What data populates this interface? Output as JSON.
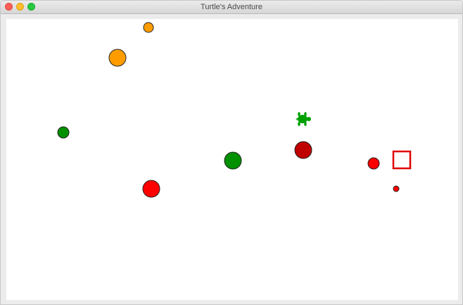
{
  "window": {
    "title": "Turtle's Adventure"
  },
  "colors": {
    "orange": "#ff9d00",
    "green": "#009000",
    "red": "#ff0000",
    "dark_red": "#c00000",
    "turtle": "#00a000",
    "home_outline": "#e00000"
  },
  "sprites": [
    {
      "kind": "ball",
      "color": "orange"
    },
    {
      "kind": "ball",
      "color": "orange"
    },
    {
      "kind": "ball",
      "color": "green"
    },
    {
      "kind": "ball",
      "color": "green"
    },
    {
      "kind": "ball",
      "color": "red"
    },
    {
      "kind": "ball",
      "color": "dark_red"
    },
    {
      "kind": "ball",
      "color": "red"
    },
    {
      "kind": "ball",
      "color": "red"
    },
    {
      "kind": "player-turtle",
      "color": "turtle"
    },
    {
      "kind": "home-goal",
      "color": "home_outline"
    }
  ]
}
